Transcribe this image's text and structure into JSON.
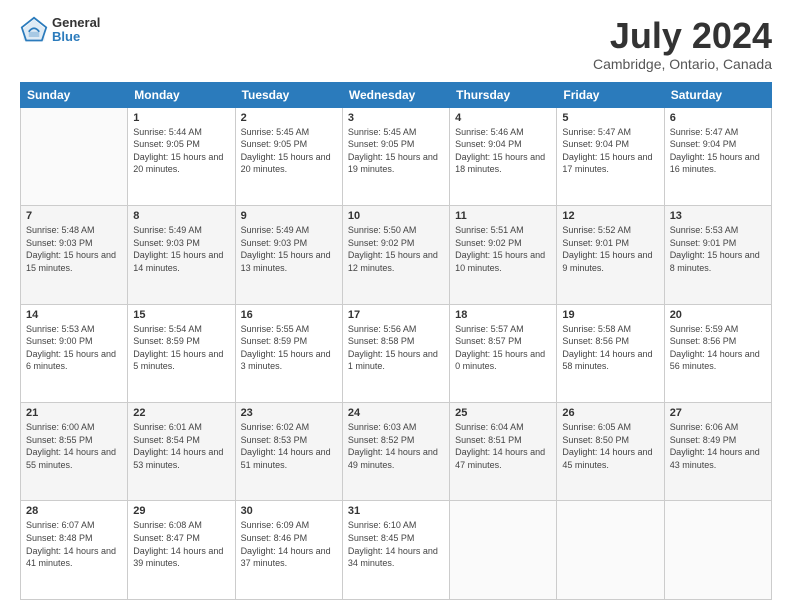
{
  "logo": {
    "general": "General",
    "blue": "Blue"
  },
  "title": {
    "month_year": "July 2024",
    "location": "Cambridge, Ontario, Canada"
  },
  "weekdays": [
    "Sunday",
    "Monday",
    "Tuesday",
    "Wednesday",
    "Thursday",
    "Friday",
    "Saturday"
  ],
  "weeks": [
    [
      {
        "date": "",
        "sunrise": "",
        "sunset": "",
        "daylight": ""
      },
      {
        "date": "1",
        "sunrise": "Sunrise: 5:44 AM",
        "sunset": "Sunset: 9:05 PM",
        "daylight": "Daylight: 15 hours and 20 minutes."
      },
      {
        "date": "2",
        "sunrise": "Sunrise: 5:45 AM",
        "sunset": "Sunset: 9:05 PM",
        "daylight": "Daylight: 15 hours and 20 minutes."
      },
      {
        "date": "3",
        "sunrise": "Sunrise: 5:45 AM",
        "sunset": "Sunset: 9:05 PM",
        "daylight": "Daylight: 15 hours and 19 minutes."
      },
      {
        "date": "4",
        "sunrise": "Sunrise: 5:46 AM",
        "sunset": "Sunset: 9:04 PM",
        "daylight": "Daylight: 15 hours and 18 minutes."
      },
      {
        "date": "5",
        "sunrise": "Sunrise: 5:47 AM",
        "sunset": "Sunset: 9:04 PM",
        "daylight": "Daylight: 15 hours and 17 minutes."
      },
      {
        "date": "6",
        "sunrise": "Sunrise: 5:47 AM",
        "sunset": "Sunset: 9:04 PM",
        "daylight": "Daylight: 15 hours and 16 minutes."
      }
    ],
    [
      {
        "date": "7",
        "sunrise": "Sunrise: 5:48 AM",
        "sunset": "Sunset: 9:03 PM",
        "daylight": "Daylight: 15 hours and 15 minutes."
      },
      {
        "date": "8",
        "sunrise": "Sunrise: 5:49 AM",
        "sunset": "Sunset: 9:03 PM",
        "daylight": "Daylight: 15 hours and 14 minutes."
      },
      {
        "date": "9",
        "sunrise": "Sunrise: 5:49 AM",
        "sunset": "Sunset: 9:03 PM",
        "daylight": "Daylight: 15 hours and 13 minutes."
      },
      {
        "date": "10",
        "sunrise": "Sunrise: 5:50 AM",
        "sunset": "Sunset: 9:02 PM",
        "daylight": "Daylight: 15 hours and 12 minutes."
      },
      {
        "date": "11",
        "sunrise": "Sunrise: 5:51 AM",
        "sunset": "Sunset: 9:02 PM",
        "daylight": "Daylight: 15 hours and 10 minutes."
      },
      {
        "date": "12",
        "sunrise": "Sunrise: 5:52 AM",
        "sunset": "Sunset: 9:01 PM",
        "daylight": "Daylight: 15 hours and 9 minutes."
      },
      {
        "date": "13",
        "sunrise": "Sunrise: 5:53 AM",
        "sunset": "Sunset: 9:01 PM",
        "daylight": "Daylight: 15 hours and 8 minutes."
      }
    ],
    [
      {
        "date": "14",
        "sunrise": "Sunrise: 5:53 AM",
        "sunset": "Sunset: 9:00 PM",
        "daylight": "Daylight: 15 hours and 6 minutes."
      },
      {
        "date": "15",
        "sunrise": "Sunrise: 5:54 AM",
        "sunset": "Sunset: 8:59 PM",
        "daylight": "Daylight: 15 hours and 5 minutes."
      },
      {
        "date": "16",
        "sunrise": "Sunrise: 5:55 AM",
        "sunset": "Sunset: 8:59 PM",
        "daylight": "Daylight: 15 hours and 3 minutes."
      },
      {
        "date": "17",
        "sunrise": "Sunrise: 5:56 AM",
        "sunset": "Sunset: 8:58 PM",
        "daylight": "Daylight: 15 hours and 1 minute."
      },
      {
        "date": "18",
        "sunrise": "Sunrise: 5:57 AM",
        "sunset": "Sunset: 8:57 PM",
        "daylight": "Daylight: 15 hours and 0 minutes."
      },
      {
        "date": "19",
        "sunrise": "Sunrise: 5:58 AM",
        "sunset": "Sunset: 8:56 PM",
        "daylight": "Daylight: 14 hours and 58 minutes."
      },
      {
        "date": "20",
        "sunrise": "Sunrise: 5:59 AM",
        "sunset": "Sunset: 8:56 PM",
        "daylight": "Daylight: 14 hours and 56 minutes."
      }
    ],
    [
      {
        "date": "21",
        "sunrise": "Sunrise: 6:00 AM",
        "sunset": "Sunset: 8:55 PM",
        "daylight": "Daylight: 14 hours and 55 minutes."
      },
      {
        "date": "22",
        "sunrise": "Sunrise: 6:01 AM",
        "sunset": "Sunset: 8:54 PM",
        "daylight": "Daylight: 14 hours and 53 minutes."
      },
      {
        "date": "23",
        "sunrise": "Sunrise: 6:02 AM",
        "sunset": "Sunset: 8:53 PM",
        "daylight": "Daylight: 14 hours and 51 minutes."
      },
      {
        "date": "24",
        "sunrise": "Sunrise: 6:03 AM",
        "sunset": "Sunset: 8:52 PM",
        "daylight": "Daylight: 14 hours and 49 minutes."
      },
      {
        "date": "25",
        "sunrise": "Sunrise: 6:04 AM",
        "sunset": "Sunset: 8:51 PM",
        "daylight": "Daylight: 14 hours and 47 minutes."
      },
      {
        "date": "26",
        "sunrise": "Sunrise: 6:05 AM",
        "sunset": "Sunset: 8:50 PM",
        "daylight": "Daylight: 14 hours and 45 minutes."
      },
      {
        "date": "27",
        "sunrise": "Sunrise: 6:06 AM",
        "sunset": "Sunset: 8:49 PM",
        "daylight": "Daylight: 14 hours and 43 minutes."
      }
    ],
    [
      {
        "date": "28",
        "sunrise": "Sunrise: 6:07 AM",
        "sunset": "Sunset: 8:48 PM",
        "daylight": "Daylight: 14 hours and 41 minutes."
      },
      {
        "date": "29",
        "sunrise": "Sunrise: 6:08 AM",
        "sunset": "Sunset: 8:47 PM",
        "daylight": "Daylight: 14 hours and 39 minutes."
      },
      {
        "date": "30",
        "sunrise": "Sunrise: 6:09 AM",
        "sunset": "Sunset: 8:46 PM",
        "daylight": "Daylight: 14 hours and 37 minutes."
      },
      {
        "date": "31",
        "sunrise": "Sunrise: 6:10 AM",
        "sunset": "Sunset: 8:45 PM",
        "daylight": "Daylight: 14 hours and 34 minutes."
      },
      {
        "date": "",
        "sunrise": "",
        "sunset": "",
        "daylight": ""
      },
      {
        "date": "",
        "sunrise": "",
        "sunset": "",
        "daylight": ""
      },
      {
        "date": "",
        "sunrise": "",
        "sunset": "",
        "daylight": ""
      }
    ]
  ]
}
